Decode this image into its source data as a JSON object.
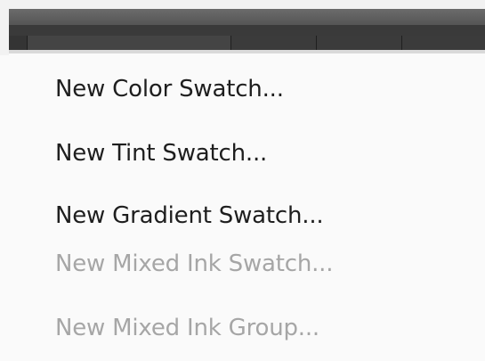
{
  "menu": {
    "items": [
      {
        "label": "New Color Swatch...",
        "enabled": true
      },
      {
        "label": "New Tint Swatch...",
        "enabled": true
      },
      {
        "label": "New Gradient Swatch...",
        "enabled": true
      },
      {
        "label": "New Mixed Ink Swatch...",
        "enabled": false
      },
      {
        "label": "New Mixed Ink Group...",
        "enabled": false
      }
    ]
  },
  "colors": {
    "enabled_text": "#1e1e1e",
    "disabled_text": "#a6a6a6",
    "menu_background": "#fafafa"
  }
}
